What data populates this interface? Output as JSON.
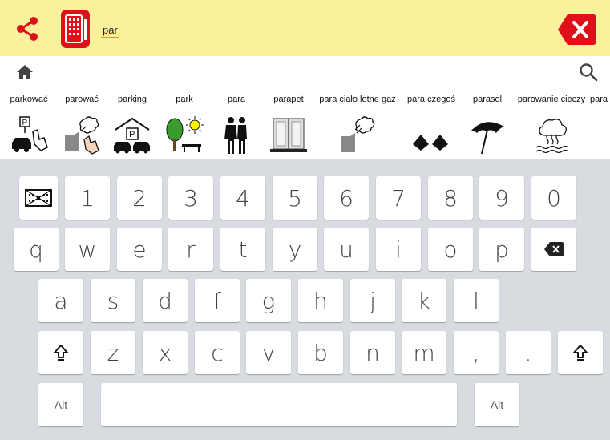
{
  "topbar": {
    "icons": {
      "share": "share-icon",
      "app": "keyboard-grid-icon",
      "clear": "backspace-clear-icon"
    },
    "text_value": "par"
  },
  "navbar": {
    "home_icon": "home-icon",
    "search_icon": "search-icon"
  },
  "suggestions": [
    {
      "label": "parkować",
      "icon": "parking-hand-icon"
    },
    {
      "label": "parować",
      "icon": "steam-hand-icon"
    },
    {
      "label": "parking",
      "icon": "parking-garage-icon"
    },
    {
      "label": "park",
      "icon": "park-tree-icon"
    },
    {
      "label": "para",
      "icon": "couple-icon"
    },
    {
      "label": "parapet",
      "icon": "windowsill-icon"
    },
    {
      "label": "para ciało lotne gaz",
      "icon": "steam-icon"
    },
    {
      "label": "para czegoś",
      "icon": "pair-icon"
    },
    {
      "label": "parasol",
      "icon": "umbrella-icon"
    },
    {
      "label": "parowanie cieczy",
      "icon": "evaporation-icon"
    },
    {
      "label": "para",
      "icon": ""
    }
  ],
  "keyboard": {
    "row1": [
      "1",
      "2",
      "3",
      "4",
      "5",
      "6",
      "7",
      "8",
      "9",
      "0"
    ],
    "row2": [
      "q",
      "w",
      "e",
      "r",
      "t",
      "y",
      "u",
      "i",
      "o",
      "p"
    ],
    "row3": [
      "a",
      "s",
      "d",
      "f",
      "g",
      "h",
      "j",
      "k",
      "l"
    ],
    "row4": [
      "z",
      "x",
      "c",
      "v",
      "b",
      "n",
      "m",
      ",",
      "."
    ],
    "alt_label": "Alt",
    "special_icons": {
      "emoji": "symbol-grid-icon",
      "backspace": "backspace-icon",
      "shift": "shift-icon"
    }
  },
  "colors": {
    "topbar": "#fbf09c",
    "accent_red": "#e0101b",
    "keyboard_bg": "#d8dbe0"
  }
}
